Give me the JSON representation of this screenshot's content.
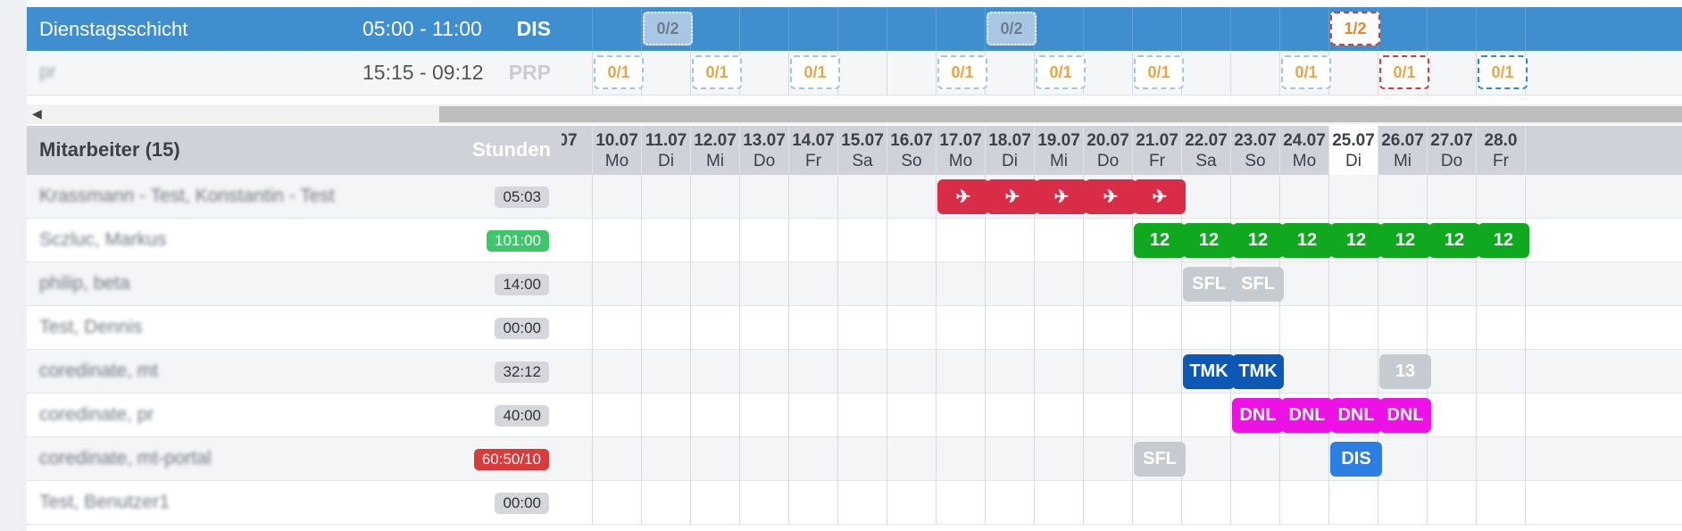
{
  "shift": {
    "name": "Dienstagsschicht",
    "time": "05:00 - 11:00",
    "code": "DIS"
  },
  "pr": {
    "name": "pr",
    "time": "15:15 - 09:12",
    "code": "PRP"
  },
  "header": {
    "title": "Mitarbeiter (15)",
    "hours": "Stunden"
  },
  "days": [
    {
      "date": "07",
      "weekday": ""
    },
    {
      "date": "10.07",
      "weekday": "Mo"
    },
    {
      "date": "11.07",
      "weekday": "Di"
    },
    {
      "date": "12.07",
      "weekday": "Mi"
    },
    {
      "date": "13.07",
      "weekday": "Do"
    },
    {
      "date": "14.07",
      "weekday": "Fr"
    },
    {
      "date": "15.07",
      "weekday": "Sa"
    },
    {
      "date": "16.07",
      "weekday": "So"
    },
    {
      "date": "17.07",
      "weekday": "Mo"
    },
    {
      "date": "18.07",
      "weekday": "Di"
    },
    {
      "date": "19.07",
      "weekday": "Mi"
    },
    {
      "date": "20.07",
      "weekday": "Do"
    },
    {
      "date": "21.07",
      "weekday": "Fr"
    },
    {
      "date": "22.07",
      "weekday": "Sa"
    },
    {
      "date": "23.07",
      "weekday": "So"
    },
    {
      "date": "24.07",
      "weekday": "Mo"
    },
    {
      "date": "25.07",
      "weekday": "Di"
    },
    {
      "date": "26.07",
      "weekday": "Mi"
    },
    {
      "date": "27.07",
      "weekday": "Do"
    },
    {
      "date": "28.0",
      "weekday": "Fr"
    }
  ],
  "today_index": 16,
  "shift_slots": [
    {
      "col": 2,
      "label": "0/2",
      "style": "grey"
    },
    {
      "col": 9,
      "label": "0/2",
      "style": "grey"
    },
    {
      "col": 16,
      "label": "1/2",
      "style": "white"
    }
  ],
  "pr_slots": [
    {
      "col": 1,
      "label": "0/1",
      "style": "dash-blue"
    },
    {
      "col": 3,
      "label": "0/1",
      "style": "dash-blue"
    },
    {
      "col": 5,
      "label": "0/1",
      "style": "dash-blue"
    },
    {
      "col": 8,
      "label": "0/1",
      "style": "dash-blue"
    },
    {
      "col": 10,
      "label": "0/1",
      "style": "dash-blue"
    },
    {
      "col": 12,
      "label": "0/1",
      "style": "dash-blue"
    },
    {
      "col": 15,
      "label": "0/1",
      "style": "dash-blue"
    },
    {
      "col": 17,
      "label": "0/1",
      "style": "dash-red"
    },
    {
      "col": 19,
      "label": "0/1",
      "style": "dash-strong"
    }
  ],
  "employees": [
    {
      "name": "Krassmann - Test, Konstantin - Test",
      "hours": "05:03",
      "badge": "grey",
      "chips": [
        {
          "col": 8,
          "label": "✈",
          "color": "red"
        },
        {
          "col": 9,
          "label": "✈",
          "color": "red"
        },
        {
          "col": 10,
          "label": "✈",
          "color": "red"
        },
        {
          "col": 11,
          "label": "✈",
          "color": "red"
        },
        {
          "col": 12,
          "label": "✈",
          "color": "red"
        }
      ]
    },
    {
      "name": "Sczluc, Markus",
      "hours": "101:00",
      "badge": "green",
      "chips": [
        {
          "col": 12,
          "label": "12",
          "color": "green"
        },
        {
          "col": 13,
          "label": "12",
          "color": "green"
        },
        {
          "col": 14,
          "label": "12",
          "color": "green"
        },
        {
          "col": 15,
          "label": "12",
          "color": "green"
        },
        {
          "col": 16,
          "label": "12",
          "color": "green"
        },
        {
          "col": 17,
          "label": "12",
          "color": "green"
        },
        {
          "col": 18,
          "label": "12",
          "color": "green"
        },
        {
          "col": 19,
          "label": "12",
          "color": "green"
        }
      ]
    },
    {
      "name": "philip, beta",
      "hours": "14:00",
      "badge": "grey",
      "chips": [
        {
          "col": 13,
          "label": "SFL",
          "color": "grey"
        },
        {
          "col": 14,
          "label": "SFL",
          "color": "grey"
        }
      ]
    },
    {
      "name": "Test, Dennis",
      "hours": "00:00",
      "badge": "grey",
      "chips": []
    },
    {
      "name": "coredinate, mt",
      "hours": "32:12",
      "badge": "grey",
      "chips": [
        {
          "col": 13,
          "label": "TMK",
          "color": "navy"
        },
        {
          "col": 14,
          "label": "TMK",
          "color": "navy"
        },
        {
          "col": 17,
          "label": "13",
          "color": "grey"
        }
      ]
    },
    {
      "name": "coredinate, pr",
      "hours": "40:00",
      "badge": "grey",
      "chips": [
        {
          "col": 14,
          "label": "DNL",
          "color": "magenta"
        },
        {
          "col": 15,
          "label": "DNL",
          "color": "magenta"
        },
        {
          "col": 16,
          "label": "DNL",
          "color": "magenta"
        },
        {
          "col": 17,
          "label": "DNL",
          "color": "magenta"
        }
      ]
    },
    {
      "name": "coredinate, mt-portal",
      "hours": "60:50/10",
      "badge": "red",
      "chips": [
        {
          "col": 12,
          "label": "SFL",
          "color": "grey"
        },
        {
          "col": 16,
          "label": "DIS",
          "color": "blue"
        }
      ]
    },
    {
      "name": "Test, Benutzer1",
      "hours": "00:00",
      "badge": "grey",
      "chips": []
    }
  ]
}
